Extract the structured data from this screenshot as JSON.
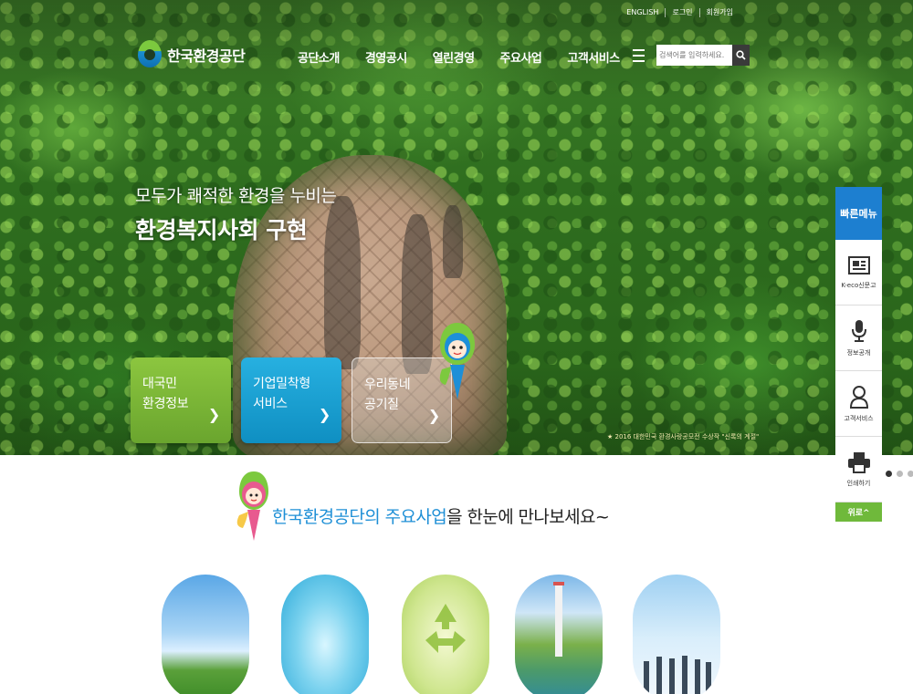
{
  "header": {
    "util_links": [
      "ENGLISH",
      "로그인",
      "회원가입"
    ],
    "logo_text": "한국환경공단",
    "nav": [
      "공단소개",
      "경영공시",
      "열린경영",
      "주요사업",
      "고객서비스"
    ],
    "search_placeholder": "검색어를 입력하세요."
  },
  "hero": {
    "headline_line1": "모두가 쾌적한 환경을 누비는",
    "headline_line2": "환경복지사회 구현",
    "cards": [
      {
        "line1": "대국민",
        "line2": "환경정보",
        "arrow": "❯"
      },
      {
        "line1": "기업밀착형",
        "line2": "서비스",
        "arrow": "❯"
      },
      {
        "line1": "우리동네",
        "line2": "공기질",
        "arrow": "❯"
      }
    ],
    "award_text": "2016 대한민국 환경사랑공모전 수상작 \"신록의 계절\""
  },
  "quick_menu": {
    "title": "빠른메뉴",
    "items": [
      {
        "label": "K-eco신문고",
        "icon": "newspaper-icon"
      },
      {
        "label": "정보공개",
        "icon": "microphone-icon"
      },
      {
        "label": "고객서비스",
        "icon": "person-icon"
      },
      {
        "label": "인쇄하기",
        "icon": "printer-icon"
      }
    ],
    "top_button": "위로^"
  },
  "main": {
    "title_highlight": "한국환경공단의 주요사업",
    "title_rest": "을 한눈에 만나보세요~"
  },
  "colors": {
    "accent_blue": "#1d7fd0",
    "accent_green": "#6fb93b",
    "title_blue": "#1e8fd6"
  }
}
